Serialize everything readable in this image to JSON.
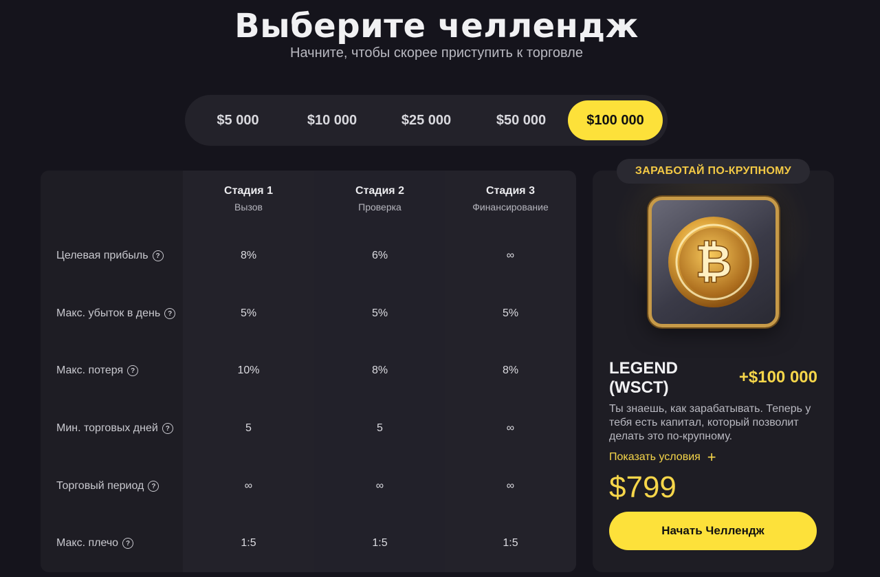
{
  "header": {
    "title": "Выберите челлендж",
    "subtitle": "Начните, чтобы скорее приступить к торговле"
  },
  "amount_tabs": [
    {
      "label": "$5 000",
      "active": false
    },
    {
      "label": "$10 000",
      "active": false
    },
    {
      "label": "$25 000",
      "active": false
    },
    {
      "label": "$50 000",
      "active": false
    },
    {
      "label": "$100 000",
      "active": true
    }
  ],
  "stages": [
    {
      "name": "Стадия 1",
      "sub": "Вызов"
    },
    {
      "name": "Стадия 2",
      "sub": "Проверка"
    },
    {
      "name": "Стадия 3",
      "sub": "Финансирование"
    }
  ],
  "rows": [
    {
      "label": "Целевая прибыль",
      "values": [
        "8%",
        "6%",
        "∞"
      ]
    },
    {
      "label": "Макс. убыток в день",
      "values": [
        "5%",
        "5%",
        "5%"
      ]
    },
    {
      "label": "Макс. потеря",
      "values": [
        "10%",
        "8%",
        "8%"
      ]
    },
    {
      "label": "Мин. торговых дней",
      "values": [
        "5",
        "5",
        "∞"
      ]
    },
    {
      "label": "Торговый период",
      "values": [
        "∞",
        "∞",
        "∞"
      ]
    },
    {
      "label": "Макс. плечо",
      "values": [
        "1:5",
        "1:5",
        "1:5"
      ]
    }
  ],
  "help_icon": "question-circle-icon",
  "promo": {
    "badge": "ЗАРАБОТАЙ ПО-КРУПНОМУ",
    "image_icon": "bitcoin-coin-icon",
    "plan_name": "LEGEND (WSCT)",
    "bonus": "+$100 000",
    "description": "Ты знаешь, как зарабатывать. Теперь у тебя есть капитал, который позволит делать это по-крупному.",
    "show_terms": "Показать условия",
    "price": "$799",
    "cta": "Начать Челлендж"
  },
  "colors": {
    "background": "#15141c",
    "card": "#1e1d24",
    "accent": "#fde13a",
    "accent_text": "#f6d64a"
  }
}
